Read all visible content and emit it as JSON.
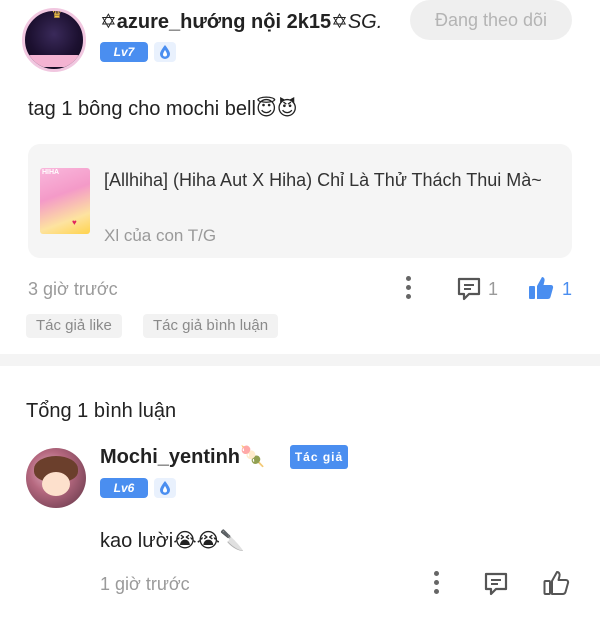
{
  "post": {
    "author": {
      "name": "✡azure_hướng nội 2k15✡",
      "name_suffix": "SG.",
      "level": "Lv7"
    },
    "follow_button": "Đang theo dõi",
    "content": "tag 1 bông cho mochi bell😇😈",
    "linked_story": {
      "title": "[Allhiha] (Hiha Aut X Hiha) Chỉ Là Thử Thách Thui Mà~",
      "subtitle": "Xl của con T/G",
      "thumbnail_text": "HIHA"
    },
    "timestamp": "3 giờ trước",
    "comment_count": "1",
    "like_count": "1",
    "tags": [
      "Tác giả like",
      "Tác giả bình luận"
    ]
  },
  "comments_section": {
    "header": "Tổng 1 bình luận",
    "comments": [
      {
        "author": "Mochi_yentinh🍡",
        "author_badge": "Tác giả",
        "level": "Lv6",
        "text": "kao lười😭😭🔪",
        "timestamp": "1 giờ trước"
      }
    ]
  },
  "colors": {
    "accent": "#4a8ef0",
    "muted_text": "#9a9a9a",
    "card_bg": "#f5f5f5",
    "follow_bg": "#efefef"
  },
  "icons": {
    "more": "more-vertical-icon",
    "comment": "comment-icon",
    "like_filled": "thumbs-up-filled-icon",
    "like_outline": "thumbs-up-outline-icon",
    "level_drop": "water-drop-icon"
  }
}
